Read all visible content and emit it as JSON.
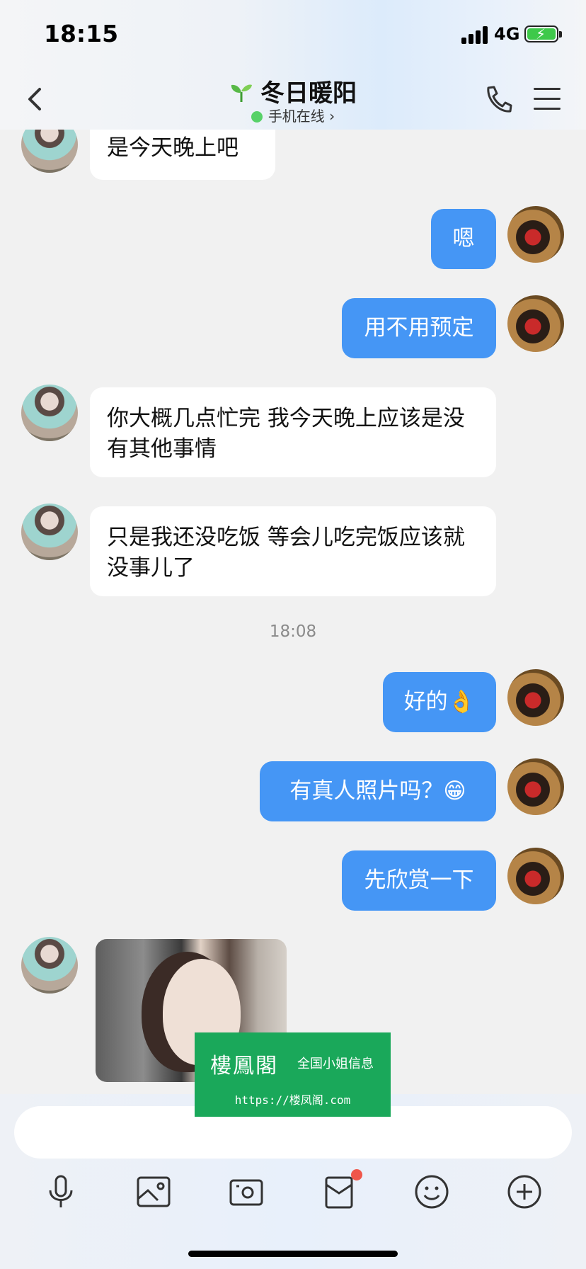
{
  "status_bar": {
    "time": "18:15",
    "network": "4G"
  },
  "header": {
    "title": "冬日暖阳",
    "subtitle": "手机在线"
  },
  "messages": [
    {
      "side": "in",
      "text": "是今天晚上吧"
    },
    {
      "side": "out",
      "text": "嗯"
    },
    {
      "side": "out",
      "text": "用不用预定"
    },
    {
      "side": "in",
      "text": "你大概几点忙完 我今天晚上应该是没有其他事情"
    },
    {
      "side": "in",
      "text": "只是我还没吃饭 等会儿吃完饭应该就没事儿了"
    },
    {
      "side": "out",
      "text": "好的👌"
    },
    {
      "side": "out",
      "text": "有真人照片吗？😁"
    },
    {
      "side": "out",
      "text": "先欣赏一下"
    }
  ],
  "timestamp": "18:08",
  "watermark": {
    "title": "樓鳳閣",
    "tagline": "全国小姐信息",
    "url": "https://楼凤阁.com"
  },
  "toolbar_icons": [
    "microphone-icon",
    "image-icon",
    "camera-icon",
    "red-envelope-icon",
    "emoji-icon",
    "plus-icon"
  ],
  "colors": {
    "accent": "#4596f5",
    "online": "#57d168",
    "watermark_bg": "#1aa85a",
    "badge": "#f0564a"
  }
}
